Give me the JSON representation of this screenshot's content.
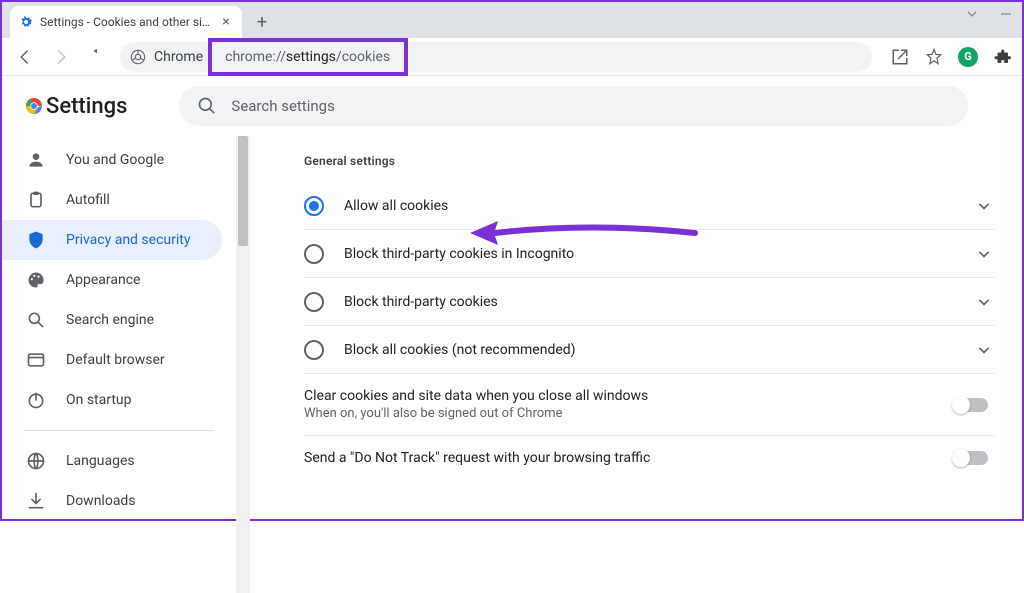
{
  "browser": {
    "tab_title": "Settings - Cookies and other site",
    "url_prefix": "Chrome",
    "url_display_before": "chrome://",
    "url_display_bold": "settings",
    "url_display_after": "/cookies"
  },
  "header": {
    "title": "Settings",
    "search_placeholder": "Search settings"
  },
  "sidebar": {
    "items": [
      {
        "id": "you",
        "label": "You and Google",
        "icon": "person-icon"
      },
      {
        "id": "autofill",
        "label": "Autofill",
        "icon": "clipboard-icon"
      },
      {
        "id": "privacy",
        "label": "Privacy and security",
        "icon": "shield-icon",
        "active": true
      },
      {
        "id": "appearance",
        "label": "Appearance",
        "icon": "palette-icon"
      },
      {
        "id": "search",
        "label": "Search engine",
        "icon": "search-icon"
      },
      {
        "id": "default",
        "label": "Default browser",
        "icon": "browser-icon"
      },
      {
        "id": "startup",
        "label": "On startup",
        "icon": "power-icon"
      }
    ],
    "items2": [
      {
        "id": "languages",
        "label": "Languages",
        "icon": "globe-icon"
      },
      {
        "id": "downloads",
        "label": "Downloads",
        "icon": "download-icon"
      }
    ]
  },
  "main": {
    "section_title": "General settings",
    "options": [
      {
        "label": "Allow all cookies",
        "selected": true
      },
      {
        "label": "Block third-party cookies in Incognito",
        "selected": false
      },
      {
        "label": "Block third-party cookies",
        "selected": false
      },
      {
        "label": "Block all cookies (not recommended)",
        "selected": false
      }
    ],
    "rows": [
      {
        "title": "Clear cookies and site data when you close all windows",
        "subtitle": "When on, you'll also be signed out of Chrome"
      },
      {
        "title": "Send a \"Do Not Track\" request with your browsing traffic"
      }
    ]
  }
}
